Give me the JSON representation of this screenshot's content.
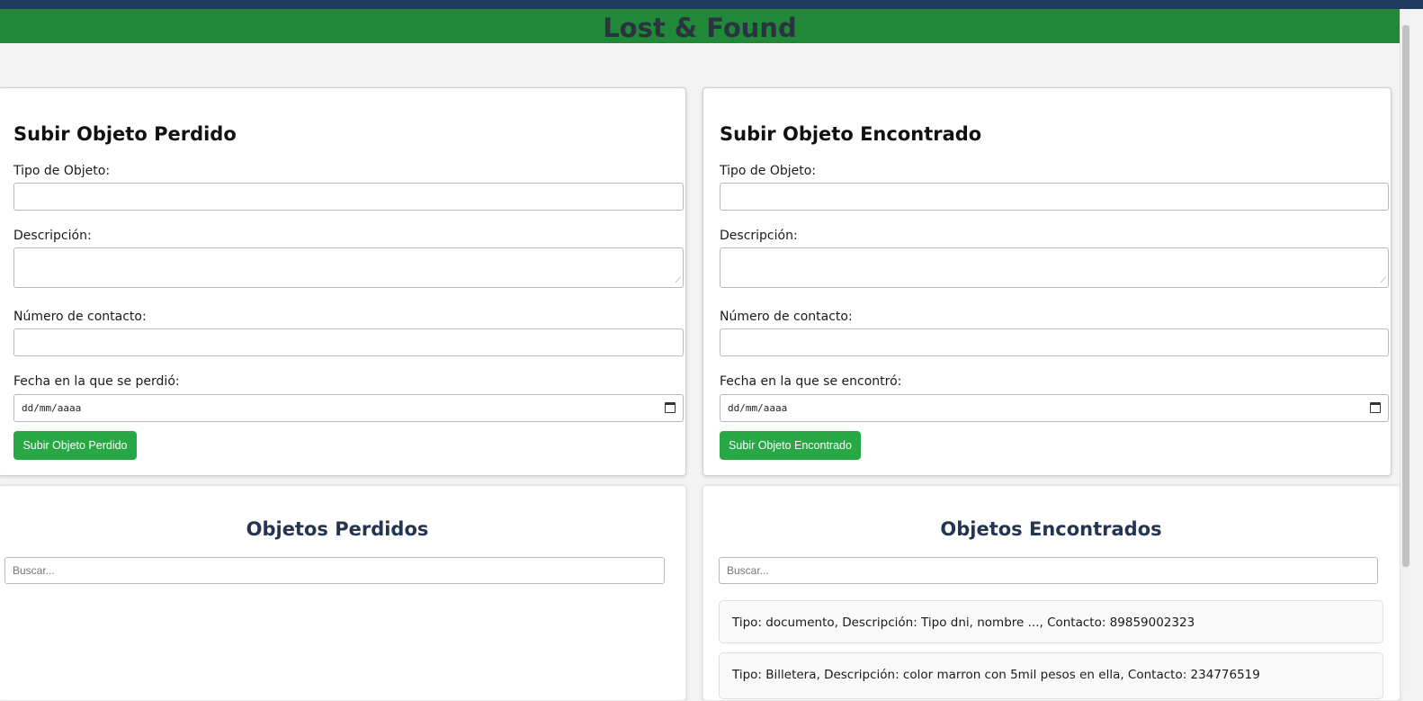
{
  "header": {
    "title": "Lost & Found"
  },
  "colors": {
    "header_bg": "#218838",
    "top_bar": "#1f3a5f",
    "button_bg": "#28a745",
    "list_title": "#24364f"
  },
  "lost_form": {
    "title": "Subir Objeto Perdido",
    "type_label": "Tipo de Objeto:",
    "type_value": "",
    "description_label": "Descripción:",
    "description_value": "",
    "contact_label": "Número de contacto:",
    "contact_value": "",
    "date_label": "Fecha en la que se perdió:",
    "date_placeholder": "dd/mm/aaaa",
    "submit_label": "Subir Objeto Perdido"
  },
  "found_form": {
    "title": "Subir Objeto Encontrado",
    "type_label": "Tipo de Objeto:",
    "type_value": "",
    "description_label": "Descripción:",
    "description_value": "",
    "contact_label": "Número de contacto:",
    "contact_value": "",
    "date_label": "Fecha en la que se encontró:",
    "date_placeholder": "dd/mm/aaaa",
    "submit_label": "Subir Objeto Encontrado"
  },
  "lost_list": {
    "title": "Objetos Perdidos",
    "search_placeholder": "Buscar...",
    "items": []
  },
  "found_list": {
    "title": "Objetos Encontrados",
    "search_placeholder": "Buscar...",
    "items": [
      "Tipo: documento, Descripción: Tipo dni, nombre ..., Contacto: 89859002323",
      "Tipo: Billetera, Descripción: color marron con 5mil pesos en ella, Contacto: 234776519"
    ]
  },
  "icons": {
    "date_picker": "calendar-icon",
    "textarea_resize": "resize-grip-icon"
  }
}
